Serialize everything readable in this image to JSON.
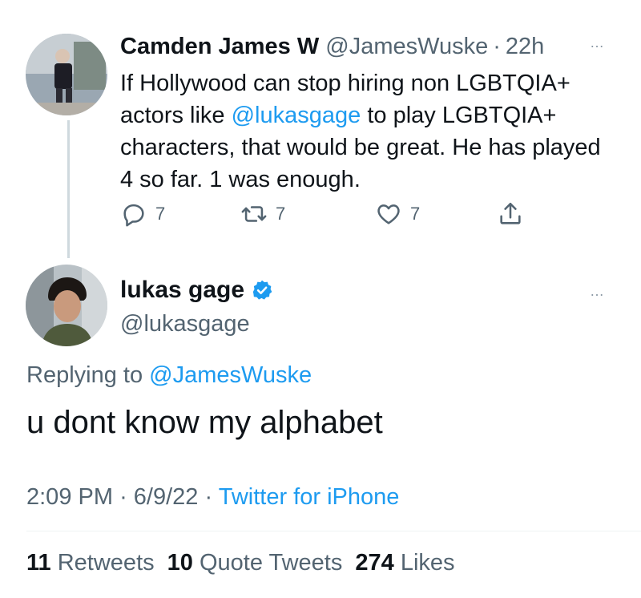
{
  "tweet1": {
    "display_name": "Camden James W",
    "handle": "@JamesWuske",
    "separator": "·",
    "time": "22h",
    "more_icon": "…",
    "text_before_mention": "If Hollywood can stop hiring non LGBTQIA+ actors like ",
    "mention": "@lukasgage",
    "text_after_mention": " to play LGBTQIA+ characters, that would be great. He has played 4 so far. 1 was enough.",
    "actions": {
      "reply_count": "7",
      "retweet_count": "7",
      "like_count": "7"
    }
  },
  "tweet2": {
    "display_name": "lukas gage",
    "handle": "@lukasgage",
    "more_icon": "…",
    "replying_prefix": "Replying to ",
    "replying_to": "@JamesWuske",
    "text": "u dont know my alphabet",
    "time": "2:09 PM",
    "date": "6/9/22",
    "separator": "·",
    "source": "Twitter for iPhone",
    "stats": {
      "retweets_count": "11",
      "retweets_label": "Retweets",
      "quotes_count": "10",
      "quotes_label": "Quote Tweets",
      "likes_count": "274",
      "likes_label": "Likes"
    }
  },
  "colors": {
    "accent": "#1d9bf0",
    "muted": "#536471",
    "text": "#0f1419",
    "thread_line": "#cfd9de"
  },
  "icons": [
    "reply-icon",
    "retweet-icon",
    "like-icon",
    "share-icon",
    "verified-badge-icon",
    "more-icon"
  ]
}
